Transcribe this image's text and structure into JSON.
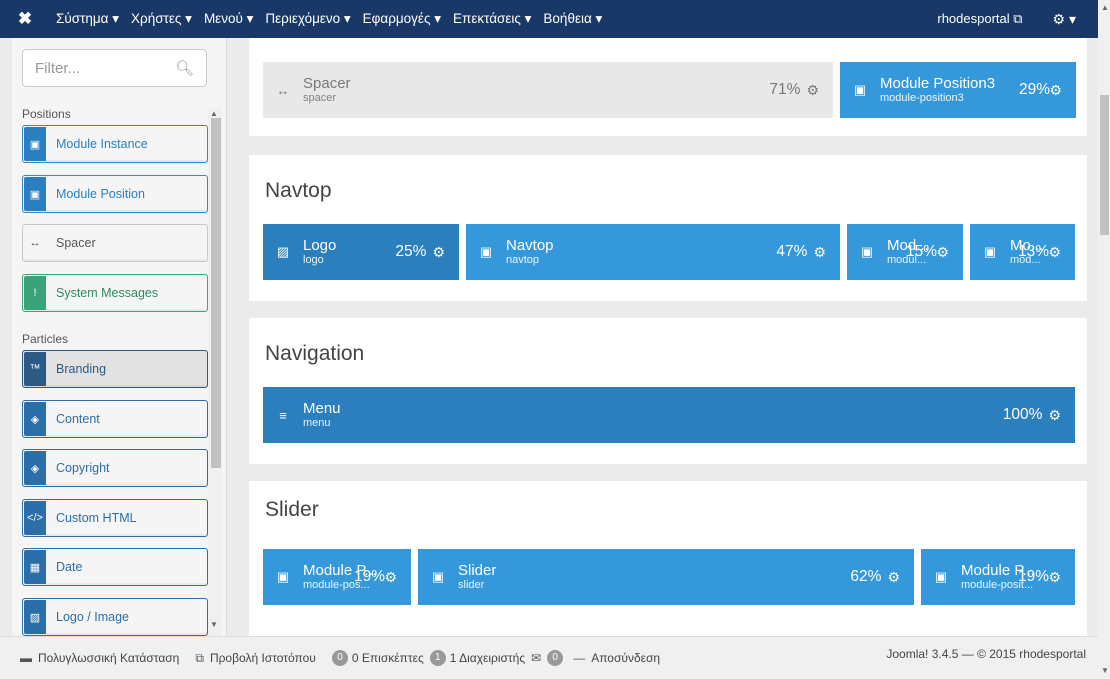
{
  "topbar": {
    "logo": "✖",
    "menu": [
      "Σύστημα ▾",
      "Χρήστες ▾",
      "Μενού ▾",
      "Περιεχόμενο ▾",
      "Εφαρμογές ▾",
      "Επεκτάσεις ▾",
      "Βοήθεια ▾"
    ],
    "user": "rhodesportal ⧉",
    "settings": "⚙ ▾"
  },
  "sidebar": {
    "filter_placeholder": "Filter...",
    "positions_title": "Positions",
    "positions": [
      {
        "label": "Module Instance",
        "icon": "module-instance-icon"
      },
      {
        "label": "Module Position",
        "icon": "module-position-icon"
      },
      {
        "label": "Spacer",
        "icon": "spacer-icon"
      },
      {
        "label": "System Messages",
        "icon": "alert-icon"
      }
    ],
    "particles_title": "Particles",
    "particles": [
      {
        "label": "Branding",
        "icon": "trademark-icon"
      },
      {
        "label": "Content",
        "icon": "cube-icon"
      },
      {
        "label": "Copyright",
        "icon": "cube-icon"
      },
      {
        "label": "Custom HTML",
        "icon": "code-icon"
      },
      {
        "label": "Date",
        "icon": "calendar-icon"
      },
      {
        "label": "Logo / Image",
        "icon": "image-icon"
      }
    ]
  },
  "main": {
    "row0": [
      {
        "name": "Spacer",
        "key": "spacer",
        "pct": "71%"
      },
      {
        "name": "Module Position3",
        "key": "module-position3",
        "pct": "29%"
      }
    ],
    "navtop": {
      "title": "Navtop",
      "blocks": [
        {
          "name": "Logo",
          "key": "logo",
          "pct": "25%"
        },
        {
          "name": "Navtop",
          "key": "navtop",
          "pct": "47%"
        },
        {
          "name": "Mod...",
          "key": "modul...",
          "pct": "15%"
        },
        {
          "name": "Mo...",
          "key": "mod...",
          "pct": "13%"
        }
      ]
    },
    "navigation": {
      "title": "Navigation",
      "blocks": [
        {
          "name": "Menu",
          "key": "menu",
          "pct": "100%"
        }
      ]
    },
    "slider": {
      "title": "Slider",
      "blocks": [
        {
          "name": "Module P...",
          "key": "module-pos...",
          "pct": "19%"
        },
        {
          "name": "Slider",
          "key": "slider",
          "pct": "62%"
        },
        {
          "name": "Module P...",
          "key": "module-posit...",
          "pct": "19%"
        }
      ]
    }
  },
  "statusbar": {
    "multilang": "Πολυγλωσσική Κατάσταση",
    "viewsite": "Προβολή Ιστοτόπου",
    "visitors_count": "0",
    "visitors": "0 Επισκέπτες",
    "admins_count": "1",
    "admins": "1 Διαχειριστής",
    "messages_count": "0",
    "logout": "Αποσύνδεση",
    "version": "Joomla! 3.4.5 — © 2015 rhodesportal"
  }
}
